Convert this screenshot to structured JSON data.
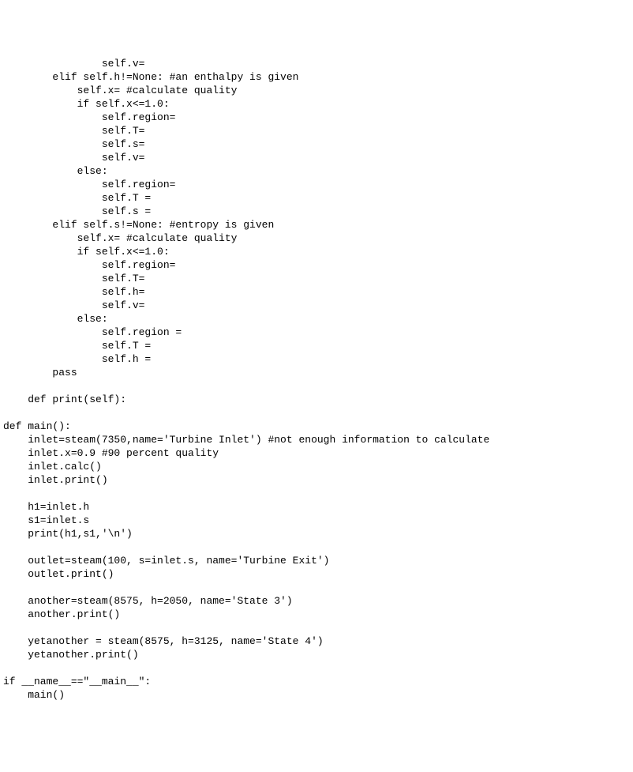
{
  "lines": [
    "                self.v=",
    "        elif self.h!=None: #an enthalpy is given",
    "            self.x= #calculate quality",
    "            if self.x<=1.0:",
    "                self.region=",
    "                self.T=",
    "                self.s=",
    "                self.v=",
    "            else:",
    "                self.region=",
    "                self.T =",
    "                self.s =",
    "        elif self.s!=None: #entropy is given",
    "            self.x= #calculate quality",
    "            if self.x<=1.0:",
    "                self.region=",
    "                self.T=",
    "                self.h=",
    "                self.v=",
    "            else:",
    "                self.region =",
    "                self.T =",
    "                self.h =",
    "        pass",
    "",
    "    def print(self):",
    "",
    "def main():",
    "    inlet=steam(7350,name='Turbine Inlet') #not enough information to calculate",
    "    inlet.x=0.9 #90 percent quality",
    "    inlet.calc()",
    "    inlet.print()",
    "",
    "    h1=inlet.h",
    "    s1=inlet.s",
    "    print(h1,s1,'\\n')",
    "",
    "    outlet=steam(100, s=inlet.s, name='Turbine Exit')",
    "    outlet.print()",
    "",
    "    another=steam(8575, h=2050, name='State 3')",
    "    another.print()",
    "",
    "    yetanother = steam(8575, h=3125, name='State 4')",
    "    yetanother.print()",
    "",
    "if __name__==\"__main__\":",
    "    main()"
  ]
}
